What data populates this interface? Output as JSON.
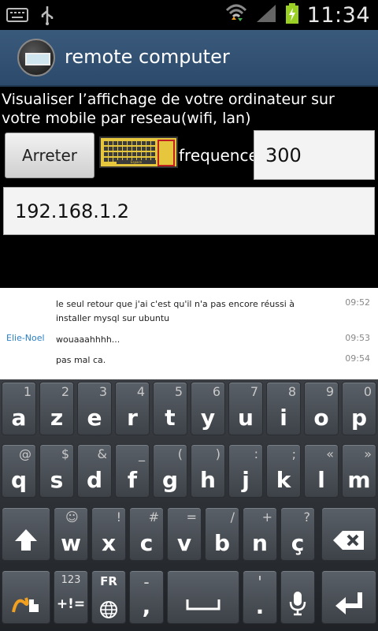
{
  "status_bar": {
    "left_icons": [
      "keyboard-icon",
      "usb-icon"
    ],
    "right_icons": [
      "wifi-icon",
      "signal-icon",
      "battery-charging-icon"
    ],
    "time": "11:34"
  },
  "action_bar": {
    "app_icon": "remote-computer-icon",
    "title": "remote computer"
  },
  "main": {
    "description": "Visualiser l’affichage de votre ordinateur sur votre mobile par reseau(wifi, lan)",
    "stop_label": "Arreter",
    "keyboard_image_caption": "Espace",
    "frequency_label": "frequence",
    "frequency_value": "300",
    "ip_value": "192.168.1.2"
  },
  "remote_screen": {
    "rows": [
      {
        "name": "",
        "message": "le seul retour que j'ai c'est qu'il n'a pas encore réussi à installer mysql sur ubuntu",
        "time": "09:52"
      },
      {
        "name": "Elie-Noel",
        "message": "wouaaahhhh...",
        "time": "09:53"
      },
      {
        "name": "",
        "message": "pas mal ca.",
        "time": "09:54"
      }
    ]
  },
  "keyboard": {
    "row1": [
      {
        "main": "a",
        "alt": "1"
      },
      {
        "main": "z",
        "alt": "2"
      },
      {
        "main": "e",
        "alt": "3"
      },
      {
        "main": "r",
        "alt": "4"
      },
      {
        "main": "t",
        "alt": "5"
      },
      {
        "main": "y",
        "alt": "6"
      },
      {
        "main": "u",
        "alt": "7"
      },
      {
        "main": "i",
        "alt": "8"
      },
      {
        "main": "o",
        "alt": "9"
      },
      {
        "main": "p",
        "alt": "0"
      }
    ],
    "row2": [
      {
        "main": "q",
        "alt": "@"
      },
      {
        "main": "s",
        "alt": "$"
      },
      {
        "main": "d",
        "alt": "&"
      },
      {
        "main": "f",
        "alt": "_"
      },
      {
        "main": "g",
        "alt": "("
      },
      {
        "main": "h",
        "alt": ")"
      },
      {
        "main": "j",
        "alt": ":"
      },
      {
        "main": "k",
        "alt": ";"
      },
      {
        "main": "l",
        "alt": "«"
      },
      {
        "main": "m",
        "alt": "»"
      }
    ],
    "row3": [
      {
        "main": "w",
        "alt": "!"
      },
      {
        "main": "x",
        "alt": "#"
      },
      {
        "main": "c",
        "alt": "="
      },
      {
        "main": "v",
        "alt": "/"
      },
      {
        "main": "b",
        "alt": "+"
      },
      {
        "main": "n",
        "alt": "?"
      },
      {
        "main": "ç",
        "alt": ""
      }
    ],
    "row3_smiley": "☺",
    "row4": {
      "symbols_top": "123",
      "symbols_bottom": "+!=",
      "lang": "FR",
      "comma": ",",
      "comma_alt": "-",
      "period": ".",
      "period_alt": "'"
    }
  }
}
